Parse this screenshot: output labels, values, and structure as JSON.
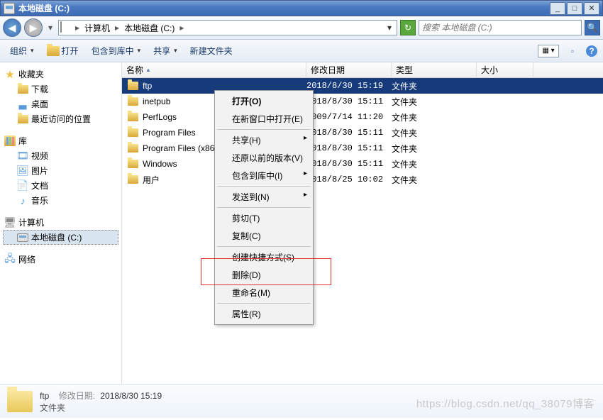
{
  "window": {
    "title": "本地磁盘 (C:)",
    "min_glyph": "_",
    "max_glyph": "□",
    "close_glyph": "✕"
  },
  "address": {
    "back_glyph": "◀",
    "fwd_glyph": "▶",
    "hist_glyph": "▾",
    "crumb_root": "计算机",
    "crumb_curr": "本地磁盘 (C:)",
    "sep": "▸",
    "drop_glyph": "▾",
    "refresh_glyph": "↻",
    "search_placeholder": "搜索 本地磁盘 (C:)",
    "search_glyph": "🔍"
  },
  "toolbar": {
    "organize": "组织",
    "open": "打开",
    "include": "包含到库中",
    "share": "共享",
    "newfolder": "新建文件夹",
    "view_glyph": "▦ ▾",
    "pane_glyph": "▫",
    "help_glyph": "?"
  },
  "sidebar": {
    "fav_label": "收藏夹",
    "fav_items": [
      {
        "label": "下载"
      },
      {
        "label": "桌面"
      },
      {
        "label": "最近访问的位置"
      }
    ],
    "lib_label": "库",
    "lib_items": [
      {
        "label": "视频",
        "glyph": "🎞"
      },
      {
        "label": "图片",
        "glyph": "🖼"
      },
      {
        "label": "文档",
        "glyph": "📄"
      },
      {
        "label": "音乐",
        "glyph": "♪"
      }
    ],
    "comp_label": "计算机",
    "comp_items": [
      {
        "label": "本地磁盘 (C:)"
      }
    ],
    "net_label": "网络",
    "net_glyph": "🖧"
  },
  "columns": {
    "name": "名称",
    "date": "修改日期",
    "type": "类型",
    "size": "大小",
    "sort_glyph": "▲"
  },
  "rows": [
    {
      "name": "ftp",
      "date": "2018/8/30 15:19",
      "type": "文件夹",
      "selected": true
    },
    {
      "name": "inetpub",
      "date": "2018/8/30 15:11",
      "type": "文件夹",
      "selected": false
    },
    {
      "name": "PerfLogs",
      "date": "2009/7/14 11:20",
      "type": "文件夹",
      "selected": false
    },
    {
      "name": "Program Files",
      "date": "2018/8/30 15:11",
      "type": "文件夹",
      "selected": false
    },
    {
      "name": "Program Files (x86)",
      "date": "2018/8/30 15:11",
      "type": "文件夹",
      "selected": false
    },
    {
      "name": "Windows",
      "date": "2018/8/30 15:11",
      "type": "文件夹",
      "selected": false
    },
    {
      "name": "用户",
      "date": "2018/8/25 10:02",
      "type": "文件夹",
      "selected": false
    }
  ],
  "context_menu": [
    {
      "label": "打开(O)",
      "bold": true
    },
    {
      "label": "在新窗口中打开(E)"
    },
    {
      "sep": true
    },
    {
      "label": "共享(H)",
      "sub": true
    },
    {
      "label": "还原以前的版本(V)"
    },
    {
      "label": "包含到库中(I)",
      "sub": true
    },
    {
      "sep": true
    },
    {
      "label": "发送到(N)",
      "sub": true
    },
    {
      "sep": true
    },
    {
      "label": "剪切(T)"
    },
    {
      "label": "复制(C)"
    },
    {
      "sep": true
    },
    {
      "label": "创建快捷方式(S)"
    },
    {
      "label": "删除(D)"
    },
    {
      "label": "重命名(M)"
    },
    {
      "sep": true
    },
    {
      "label": "属性(R)"
    }
  ],
  "details": {
    "name": "ftp",
    "date_label": "修改日期:",
    "date_value": "2018/8/30 15:19",
    "type": "文件夹"
  },
  "watermark": "https://blog.csdn.net/qq_38079博客"
}
